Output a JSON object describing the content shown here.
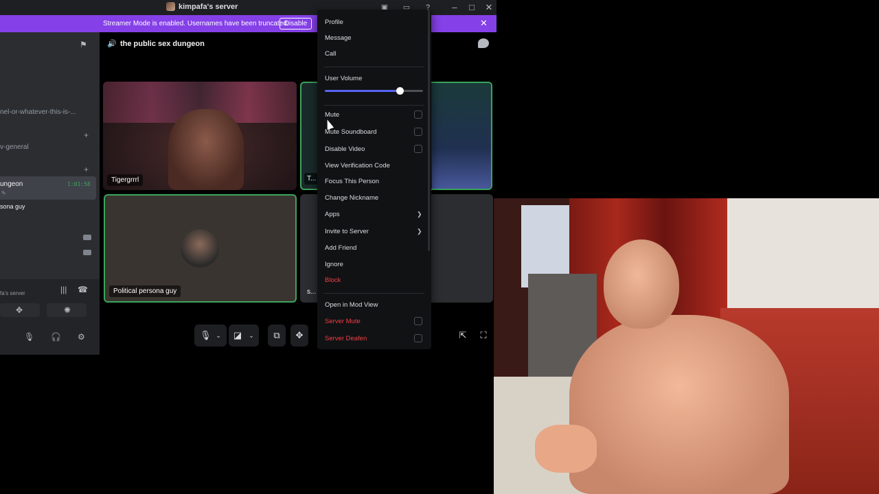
{
  "window": {
    "title": "kimpafa's server"
  },
  "banner": {
    "text": "Streamer Mode is enabled. Usernames have been truncated.",
    "disable_label": "Disable",
    "close": "✕"
  },
  "sidebar": {
    "channels": [
      {
        "label": "nel-or-whatever-this-is-..."
      },
      {
        "label": "v-general"
      }
    ],
    "active_voice": {
      "label": "ungeon",
      "timer": "1:01:58"
    },
    "members": [
      {
        "label": "sona guy"
      }
    ],
    "voice_panel": {
      "server_name": "fa's server"
    }
  },
  "main": {
    "channel_title": "the public sex dungeon",
    "tiles": {
      "tiger": "Tigergrrrl",
      "t2": "T...",
      "political": "Political persona guy",
      "s": "s..."
    }
  },
  "context_menu": {
    "items": {
      "profile": "Profile",
      "message": "Message",
      "call": "Call",
      "user_volume": "User Volume",
      "mute": "Mute",
      "mute_soundboard": "Mute Soundboard",
      "disable_video": "Disable Video",
      "view_verification_code": "View Verification Code",
      "focus_this_person": "Focus This Person",
      "change_nickname": "Change Nickname",
      "apps": "Apps",
      "invite_to_server": "Invite to Server",
      "add_friend": "Add Friend",
      "ignore": "Ignore",
      "block": "Block",
      "open_in_mod_view": "Open in Mod View",
      "server_mute": "Server Mute",
      "server_deafen": "Server Deafen"
    },
    "volume": 0.76
  },
  "colors": {
    "accent": "#5865f2",
    "banner": "#8540e8",
    "danger": "#f23f43",
    "speaking": "#3ba55c"
  }
}
